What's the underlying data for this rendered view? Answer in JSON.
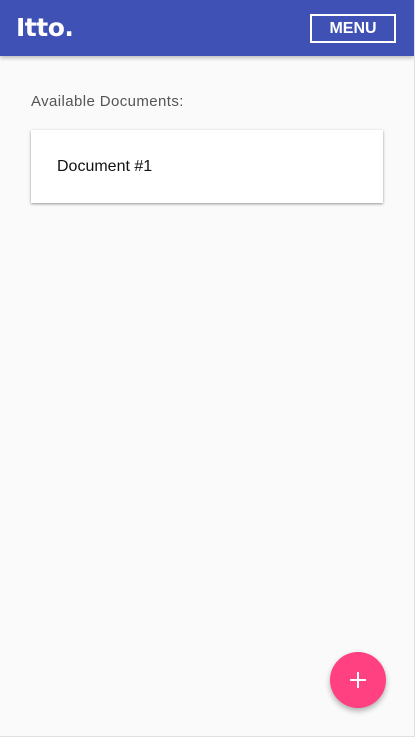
{
  "header": {
    "logo": "Itto.",
    "menu_label": "MENU"
  },
  "main": {
    "section_label": "Available Documents:",
    "documents": [
      {
        "title": "Document #1"
      }
    ]
  },
  "fab": {
    "icon": "plus-icon"
  },
  "colors": {
    "primary": "#3f51b5",
    "accent": "#ff4081",
    "background": "#fafafa"
  }
}
